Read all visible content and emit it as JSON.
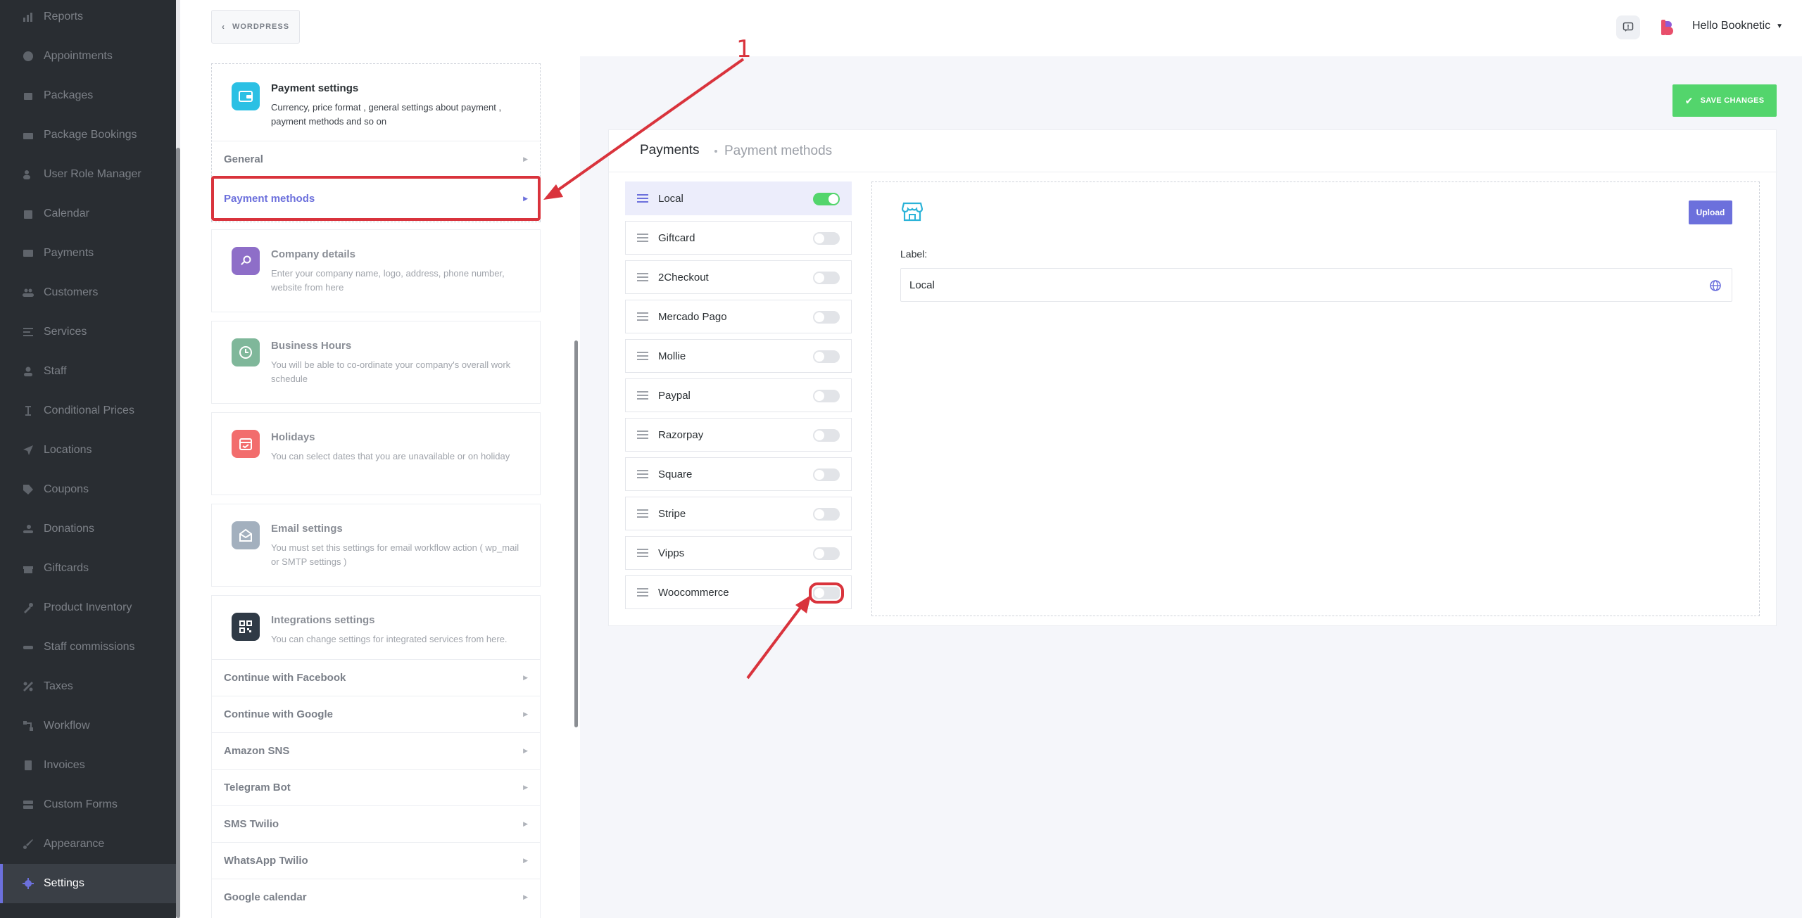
{
  "sidebar": {
    "items": [
      {
        "label": "Reports",
        "icon": "chart-icon"
      },
      {
        "label": "Appointments",
        "icon": "clock-icon"
      },
      {
        "label": "Packages",
        "icon": "package-icon"
      },
      {
        "label": "Package Bookings",
        "icon": "box-icon"
      },
      {
        "label": "User Role Manager",
        "icon": "user-gear-icon"
      },
      {
        "label": "Calendar",
        "icon": "calendar-icon"
      },
      {
        "label": "Payments",
        "icon": "card-icon"
      },
      {
        "label": "Customers",
        "icon": "users-icon"
      },
      {
        "label": "Services",
        "icon": "list-icon"
      },
      {
        "label": "Staff",
        "icon": "user-icon"
      },
      {
        "label": "Conditional Prices",
        "icon": "cursor-icon"
      },
      {
        "label": "Locations",
        "icon": "location-icon"
      },
      {
        "label": "Coupons",
        "icon": "tag-icon"
      },
      {
        "label": "Donations",
        "icon": "donation-icon"
      },
      {
        "label": "Giftcards",
        "icon": "gift-icon"
      },
      {
        "label": "Product Inventory",
        "icon": "tools-icon"
      },
      {
        "label": "Staff commissions",
        "icon": "handshake-icon"
      },
      {
        "label": "Taxes",
        "icon": "percent-icon"
      },
      {
        "label": "Workflow",
        "icon": "workflow-icon"
      },
      {
        "label": "Invoices",
        "icon": "invoice-icon"
      },
      {
        "label": "Custom Forms",
        "icon": "form-icon"
      },
      {
        "label": "Appearance",
        "icon": "brush-icon"
      },
      {
        "label": "Settings",
        "icon": "gear-icon",
        "active": true
      }
    ]
  },
  "topbar": {
    "wordpress_label": "WORDPRESS",
    "greeting": "Hello Booknetic"
  },
  "settings": {
    "payment": {
      "title": "Payment settings",
      "desc": "Currency, price format , general settings about payment , payment methods and so on",
      "sub_general": "General",
      "sub_methods": "Payment methods"
    },
    "company": {
      "title": "Company details",
      "desc": "Enter your company name, logo, address, phone number, website from here"
    },
    "hours": {
      "title": "Business Hours",
      "desc": "You will be able to co-ordinate your company's overall work schedule"
    },
    "holidays": {
      "title": "Holidays",
      "desc": "You can select dates that you are unavailable or on holiday"
    },
    "email": {
      "title": "Email settings",
      "desc": "You must set this settings for email workflow action ( wp_mail or SMTP settings )"
    },
    "integrations": {
      "title": "Integrations settings",
      "desc": "You can change settings for integrated services from here.",
      "items": [
        "Continue with Facebook",
        "Continue with Google",
        "Amazon SNS",
        "Telegram Bot",
        "SMS Twilio",
        "WhatsApp Twilio",
        "Google calendar"
      ]
    }
  },
  "main": {
    "save_label": "SAVE CHANGES",
    "title": "Payments",
    "subtitle": "Payment methods",
    "methods": [
      {
        "name": "Local",
        "enabled": true
      },
      {
        "name": "Giftcard",
        "enabled": false
      },
      {
        "name": "2Checkout",
        "enabled": false
      },
      {
        "name": "Mercado Pago",
        "enabled": false
      },
      {
        "name": "Mollie",
        "enabled": false
      },
      {
        "name": "Paypal",
        "enabled": false
      },
      {
        "name": "Razorpay",
        "enabled": false
      },
      {
        "name": "Square",
        "enabled": false
      },
      {
        "name": "Stripe",
        "enabled": false
      },
      {
        "name": "Vipps",
        "enabled": false
      },
      {
        "name": "Woocommerce",
        "enabled": false
      }
    ],
    "detail": {
      "upload_label": "Upload",
      "label_caption": "Label:",
      "label_value": "Local"
    }
  },
  "annotation": {
    "number": "1"
  },
  "colors": {
    "accent": "#6c70dc",
    "success": "#53d56c",
    "annotation": "#d9333c",
    "sidebar": "#292d32"
  }
}
